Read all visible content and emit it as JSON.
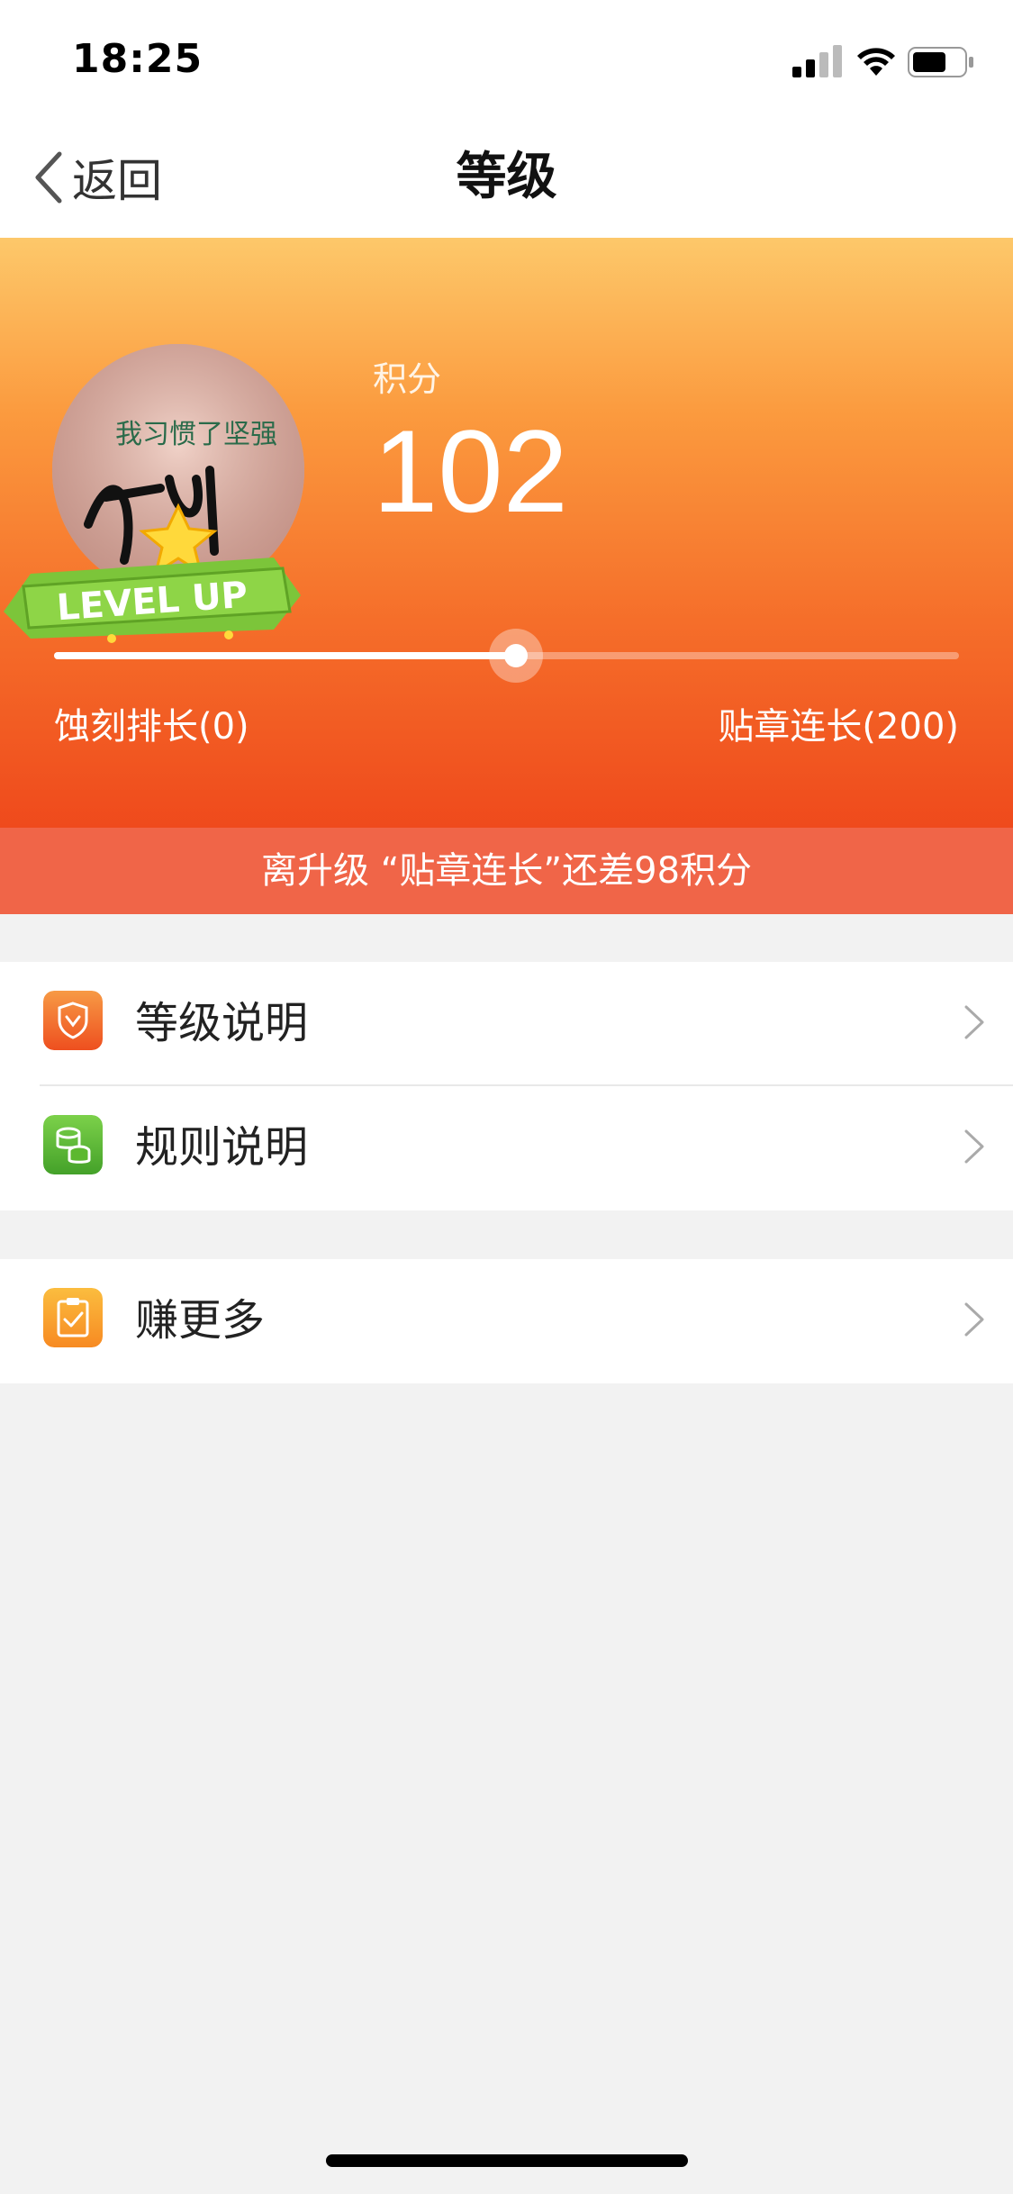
{
  "status_bar": {
    "time": "18:25",
    "signal_icon": "cellular-signal-icon",
    "wifi_icon": "wifi-icon",
    "battery_icon": "battery-icon"
  },
  "nav": {
    "back_label": "返回",
    "title": "等级",
    "back_icon": "chevron-left-icon"
  },
  "level": {
    "points_label": "积分",
    "points_value": "102",
    "avatar_badge_text": "LEVEL UP",
    "avatar_handwriting": "我习惯了坚强",
    "current_level": "蚀刻排长(0)",
    "next_level": "贴章连长(200)",
    "progress_fraction": 0.51,
    "upgrade_hint": "离升级 “贴章连长”还差98积分"
  },
  "menu": {
    "group1": [
      {
        "label": "等级说明",
        "icon": "shield-icon",
        "color": "#f26a2c"
      },
      {
        "label": "规则说明",
        "icon": "coins-icon",
        "color": "#5cb82f"
      }
    ],
    "group2": [
      {
        "label": "赚更多",
        "icon": "clipboard-check-icon",
        "color": "#f9a330"
      }
    ]
  },
  "colors": {
    "header_top": "#fdc86a",
    "header_bottom": "#ef4a1c",
    "banner": "#f06548",
    "background": "#f2f2f2"
  }
}
